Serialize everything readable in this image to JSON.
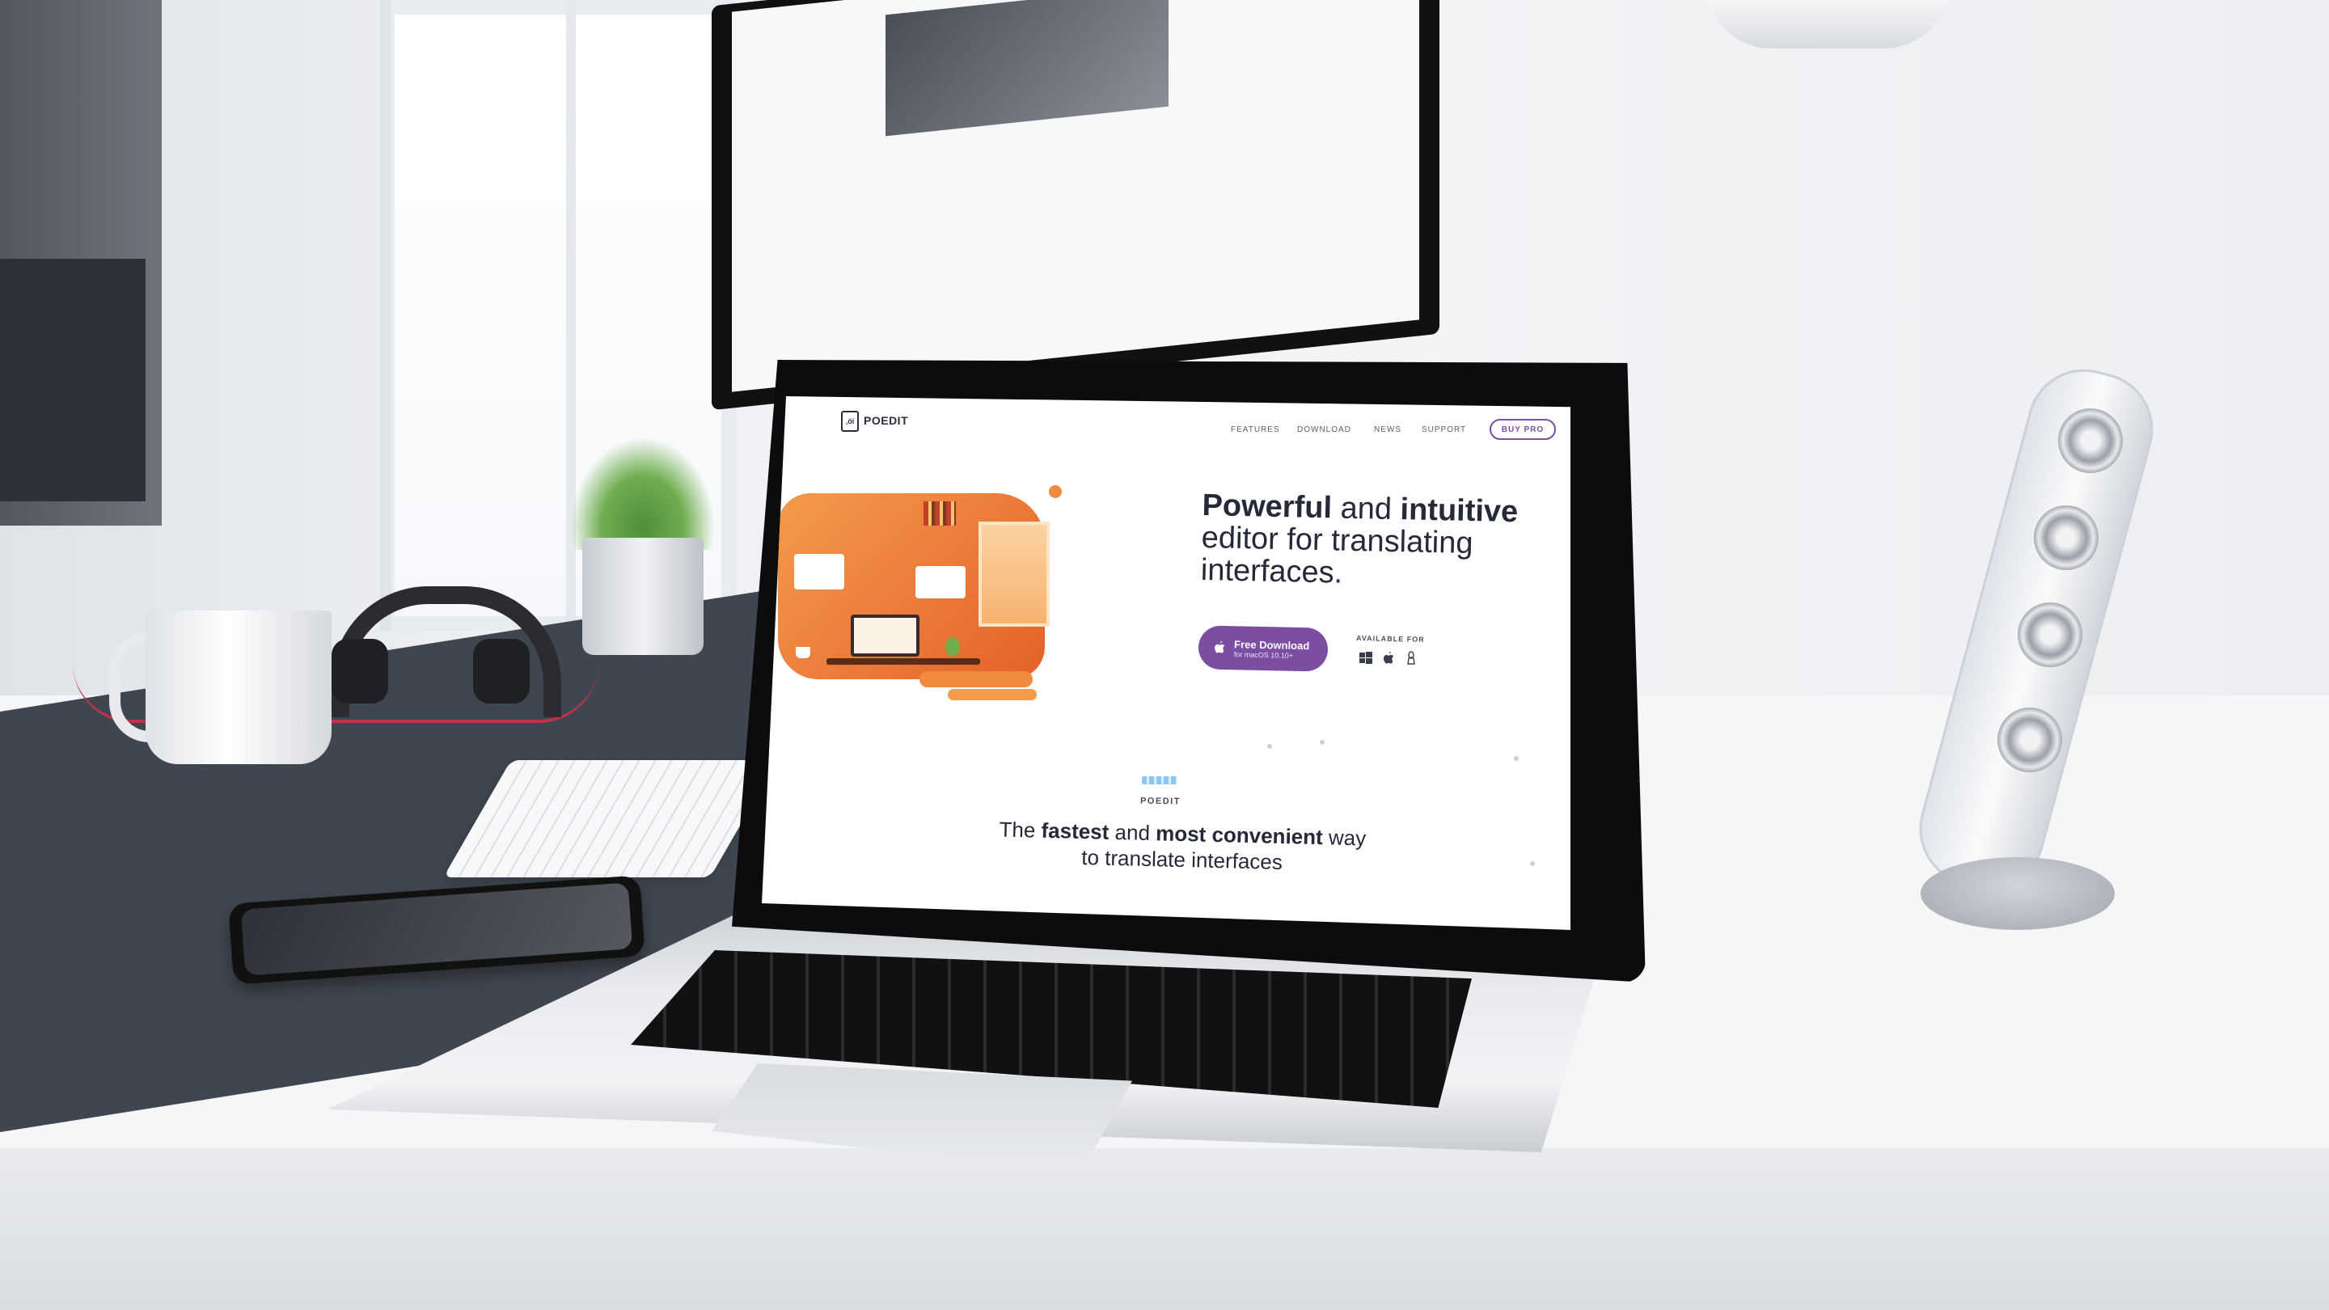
{
  "nav": {
    "logo_text": "POEDIT",
    "logo_mark": "‚öï",
    "items": [
      {
        "label": "FEATURES"
      },
      {
        "label": "DOWNLOAD"
      },
      {
        "label": "NEWS"
      },
      {
        "label": "SUPPORT"
      }
    ],
    "cta_label": "BUY PRO"
  },
  "hero": {
    "title_part_1_bold": "Powerful",
    "title_part_1_rest": " and ",
    "title_part_2_bold": "intuitive",
    "title_line_2": "editor for translating",
    "title_line_3": "interfaces.",
    "download_label": "Free Download",
    "download_sub": "for macOS 10.10+",
    "available_label": "AVAILABLE FOR",
    "platform_icons": [
      "windows-icon",
      "apple-icon",
      "linux-icon"
    ]
  },
  "section": {
    "label": "POEDIT",
    "tagline_pre": "The ",
    "tagline_bold_1": "fastest",
    "tagline_mid": " and ",
    "tagline_bold_2": "most convenient",
    "tagline_post": " way",
    "tagline_line_2": "to translate interfaces"
  },
  "colors": {
    "accent": "#7b4ea3",
    "illustration_orange": "#f08a3f",
    "text_dark": "#262a38"
  }
}
